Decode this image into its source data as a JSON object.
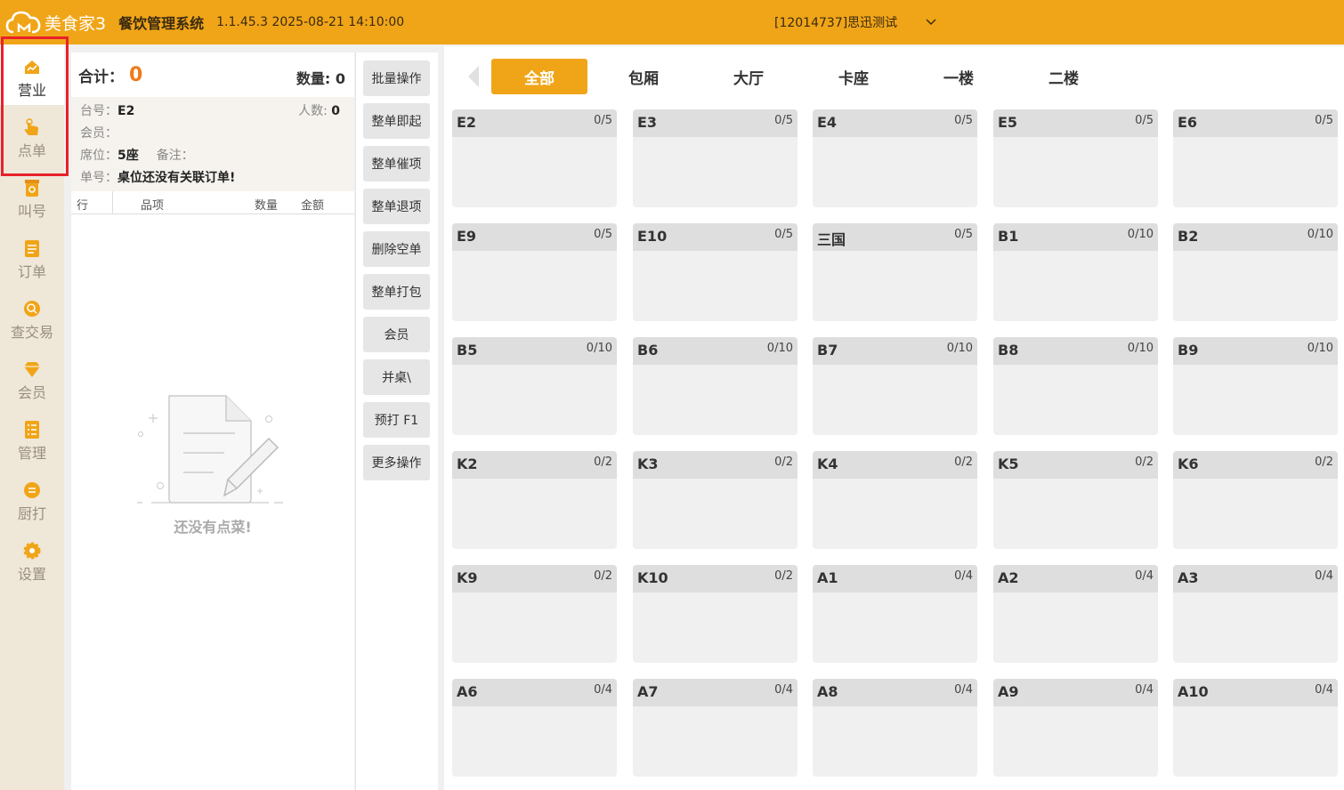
{
  "header": {
    "logo_text": "美食家3",
    "app_title": "餐饮管理系统",
    "version": "1.1.45.3 2025-08-21 14:10:00",
    "store": "[12014737]思迅测试",
    "accent_color": "#f0a518"
  },
  "nav": {
    "items": [
      {
        "label": "营业",
        "icon": "shop-icon"
      },
      {
        "label": "点单",
        "icon": "tap-icon"
      },
      {
        "label": "叫号",
        "icon": "call-number-icon"
      },
      {
        "label": "订单",
        "icon": "order-list-icon"
      },
      {
        "label": "查交易",
        "icon": "search-trade-icon"
      },
      {
        "label": "会员",
        "icon": "diamond-icon"
      },
      {
        "label": "管理",
        "icon": "manage-icon"
      },
      {
        "label": "厨打",
        "icon": "kitchen-print-icon"
      },
      {
        "label": "设置",
        "icon": "gear-icon"
      }
    ],
    "active": "营业",
    "highlight_color": "#e8212a"
  },
  "order": {
    "total_label": "合计：",
    "total_value": "0",
    "qty_label": "数量:",
    "qty_value": "0",
    "table_label": "台号：",
    "table_value": "E2",
    "people_label": "人数:",
    "people_value": "0",
    "member_label": "会员：",
    "seat_label": "席位：",
    "seat_value": "5座",
    "remark_label": "备注：",
    "order_no_label": "单号：",
    "order_no_value": "桌位还没有关联订单!",
    "columns": [
      "行",
      "品项",
      "数量",
      "金额"
    ],
    "empty_text": "还没有点菜!"
  },
  "actions": [
    "批量操作",
    "整单即起",
    "整单催项",
    "整单退项",
    "删除空单",
    "整单打包",
    "会员",
    "并桌\\",
    "预打 F1",
    "更多操作"
  ],
  "tabs": [
    "全部",
    "包厢",
    "大厅",
    "卡座",
    "一楼",
    "二楼"
  ],
  "active_tab": "全部",
  "tables": [
    {
      "name": "E2",
      "cap": "0/5"
    },
    {
      "name": "E3",
      "cap": "0/5"
    },
    {
      "name": "E4",
      "cap": "0/5"
    },
    {
      "name": "E5",
      "cap": "0/5"
    },
    {
      "name": "E6",
      "cap": "0/5"
    },
    {
      "name": "E9",
      "cap": "0/5"
    },
    {
      "name": "E10",
      "cap": "0/5"
    },
    {
      "name": "三国",
      "cap": "0/5"
    },
    {
      "name": "B1",
      "cap": "0/10"
    },
    {
      "name": "B2",
      "cap": "0/10"
    },
    {
      "name": "B5",
      "cap": "0/10"
    },
    {
      "name": "B6",
      "cap": "0/10"
    },
    {
      "name": "B7",
      "cap": "0/10"
    },
    {
      "name": "B8",
      "cap": "0/10"
    },
    {
      "name": "B9",
      "cap": "0/10"
    },
    {
      "name": "K2",
      "cap": "0/2"
    },
    {
      "name": "K3",
      "cap": "0/2"
    },
    {
      "name": "K4",
      "cap": "0/2"
    },
    {
      "name": "K5",
      "cap": "0/2"
    },
    {
      "name": "K6",
      "cap": "0/2"
    },
    {
      "name": "K9",
      "cap": "0/2"
    },
    {
      "name": "K10",
      "cap": "0/2"
    },
    {
      "name": "A1",
      "cap": "0/4"
    },
    {
      "name": "A2",
      "cap": "0/4"
    },
    {
      "name": "A3",
      "cap": "0/4"
    },
    {
      "name": "A6",
      "cap": "0/4"
    },
    {
      "name": "A7",
      "cap": "0/4"
    },
    {
      "name": "A8",
      "cap": "0/4"
    },
    {
      "name": "A9",
      "cap": "0/4"
    },
    {
      "name": "A10",
      "cap": "0/4"
    }
  ]
}
